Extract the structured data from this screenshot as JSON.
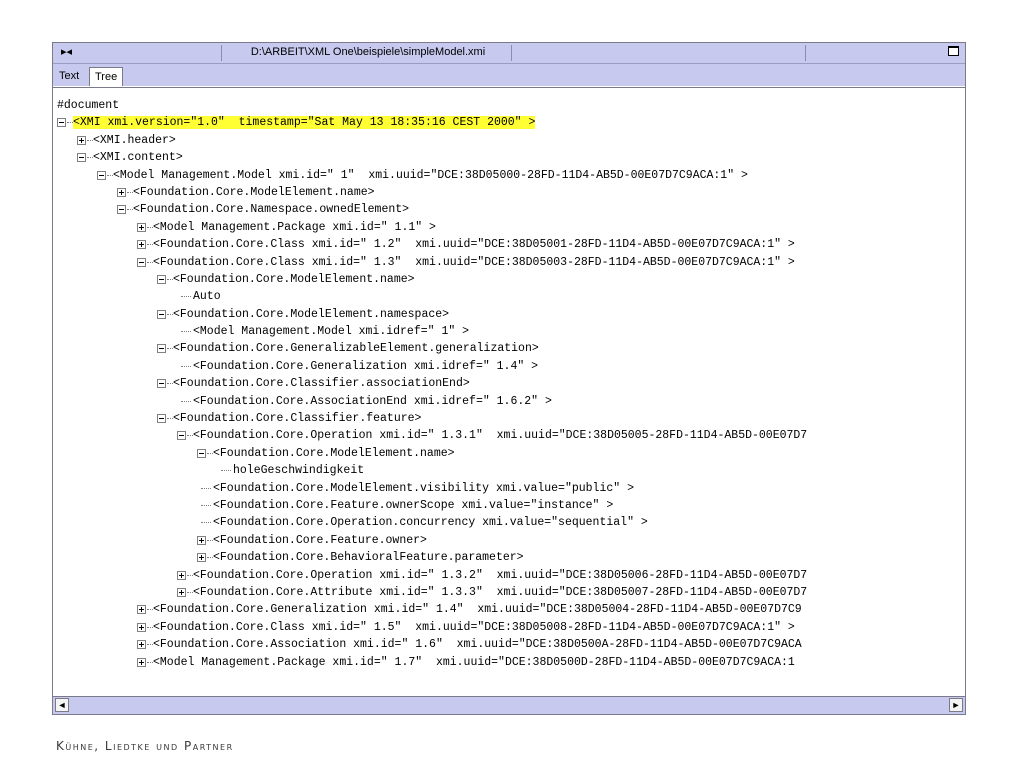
{
  "window": {
    "control_glyph": "▸◂",
    "title": "D:\\ARBEIT\\XML One\\beispiele\\simpleModel.xmi"
  },
  "tabs": [
    {
      "label": "Text",
      "active": false
    },
    {
      "label": "Tree",
      "active": true
    }
  ],
  "tree": {
    "root": "#document",
    "nodes": [
      {
        "depth": 0,
        "exp": "minus",
        "text": "<XMI xmi.version=\"1.0\"  timestamp=\"Sat May 13 18:35:16 CEST 2000\" >",
        "highlight": true
      },
      {
        "depth": 1,
        "exp": "plus",
        "text": "<XMI.header>"
      },
      {
        "depth": 1,
        "exp": "minus",
        "text": "<XMI.content>"
      },
      {
        "depth": 2,
        "exp": "minus",
        "text": "<Model Management.Model xmi.id=\" 1\"  xmi.uuid=\"DCE:38D05000-28FD-11D4-AB5D-00E07D7C9ACA:1\" >"
      },
      {
        "depth": 3,
        "exp": "plus",
        "text": "<Foundation.Core.ModelElement.name>"
      },
      {
        "depth": 3,
        "exp": "minus",
        "text": "<Foundation.Core.Namespace.ownedElement>"
      },
      {
        "depth": 4,
        "exp": "plus",
        "text": "<Model Management.Package xmi.id=\" 1.1\" >"
      },
      {
        "depth": 4,
        "exp": "plus",
        "text": "<Foundation.Core.Class xmi.id=\" 1.2\"  xmi.uuid=\"DCE:38D05001-28FD-11D4-AB5D-00E07D7C9ACA:1\" >"
      },
      {
        "depth": 4,
        "exp": "minus",
        "text": "<Foundation.Core.Class xmi.id=\" 1.3\"  xmi.uuid=\"DCE:38D05003-28FD-11D4-AB5D-00E07D7C9ACA:1\" >"
      },
      {
        "depth": 5,
        "exp": "minus",
        "text": "<Foundation.Core.ModelElement.name>"
      },
      {
        "depth": 6,
        "exp": "leaf",
        "text": "Auto"
      },
      {
        "depth": 5,
        "exp": "minus",
        "text": "<Foundation.Core.ModelElement.namespace>"
      },
      {
        "depth": 6,
        "exp": "leaf",
        "text": "<Model Management.Model xmi.idref=\" 1\" >"
      },
      {
        "depth": 5,
        "exp": "minus",
        "text": "<Foundation.Core.GeneralizableElement.generalization>"
      },
      {
        "depth": 6,
        "exp": "leaf",
        "text": "<Foundation.Core.Generalization xmi.idref=\" 1.4\" >"
      },
      {
        "depth": 5,
        "exp": "minus",
        "text": "<Foundation.Core.Classifier.associationEnd>"
      },
      {
        "depth": 6,
        "exp": "leaf",
        "text": "<Foundation.Core.AssociationEnd xmi.idref=\" 1.6.2\" >"
      },
      {
        "depth": 5,
        "exp": "minus",
        "text": "<Foundation.Core.Classifier.feature>"
      },
      {
        "depth": 6,
        "exp": "minus",
        "text": "<Foundation.Core.Operation xmi.id=\" 1.3.1\"  xmi.uuid=\"DCE:38D05005-28FD-11D4-AB5D-00E07D7"
      },
      {
        "depth": 7,
        "exp": "minus",
        "text": "<Foundation.Core.ModelElement.name>"
      },
      {
        "depth": 8,
        "exp": "leaf",
        "text": "holeGeschwindigkeit"
      },
      {
        "depth": 7,
        "exp": "leaf",
        "text": "<Foundation.Core.ModelElement.visibility xmi.value=\"public\" >"
      },
      {
        "depth": 7,
        "exp": "leaf",
        "text": "<Foundation.Core.Feature.ownerScope xmi.value=\"instance\" >"
      },
      {
        "depth": 7,
        "exp": "leaf",
        "text": "<Foundation.Core.Operation.concurrency xmi.value=\"sequential\" >"
      },
      {
        "depth": 7,
        "exp": "plus",
        "text": "<Foundation.Core.Feature.owner>"
      },
      {
        "depth": 7,
        "exp": "plus",
        "text": "<Foundation.Core.BehavioralFeature.parameter>"
      },
      {
        "depth": 6,
        "exp": "plus",
        "text": "<Foundation.Core.Operation xmi.id=\" 1.3.2\"  xmi.uuid=\"DCE:38D05006-28FD-11D4-AB5D-00E07D7"
      },
      {
        "depth": 6,
        "exp": "plus",
        "text": "<Foundation.Core.Attribute xmi.id=\" 1.3.3\"  xmi.uuid=\"DCE:38D05007-28FD-11D4-AB5D-00E07D7"
      },
      {
        "depth": 4,
        "exp": "plus",
        "text": "<Foundation.Core.Generalization xmi.id=\" 1.4\"  xmi.uuid=\"DCE:38D05004-28FD-11D4-AB5D-00E07D7C9"
      },
      {
        "depth": 4,
        "exp": "plus",
        "text": "<Foundation.Core.Class xmi.id=\" 1.5\"  xmi.uuid=\"DCE:38D05008-28FD-11D4-AB5D-00E07D7C9ACA:1\" >"
      },
      {
        "depth": 4,
        "exp": "plus",
        "text": "<Foundation.Core.Association xmi.id=\" 1.6\"  xmi.uuid=\"DCE:38D0500A-28FD-11D4-AB5D-00E07D7C9ACA"
      },
      {
        "depth": 4,
        "exp": "plus",
        "text": "<Model Management.Package xmi.id=\" 1.7\"  xmi.uuid=\"DCE:38D0500D-28FD-11D4-AB5D-00E07D7C9ACA:1"
      }
    ]
  },
  "scrollbar": {
    "left_glyph": "◄",
    "right_glyph": "►"
  },
  "footer": "Kühne, Liedtke und Partner",
  "colors": {
    "chrome": "#c7c9ee",
    "highlight": "#ffff33"
  }
}
